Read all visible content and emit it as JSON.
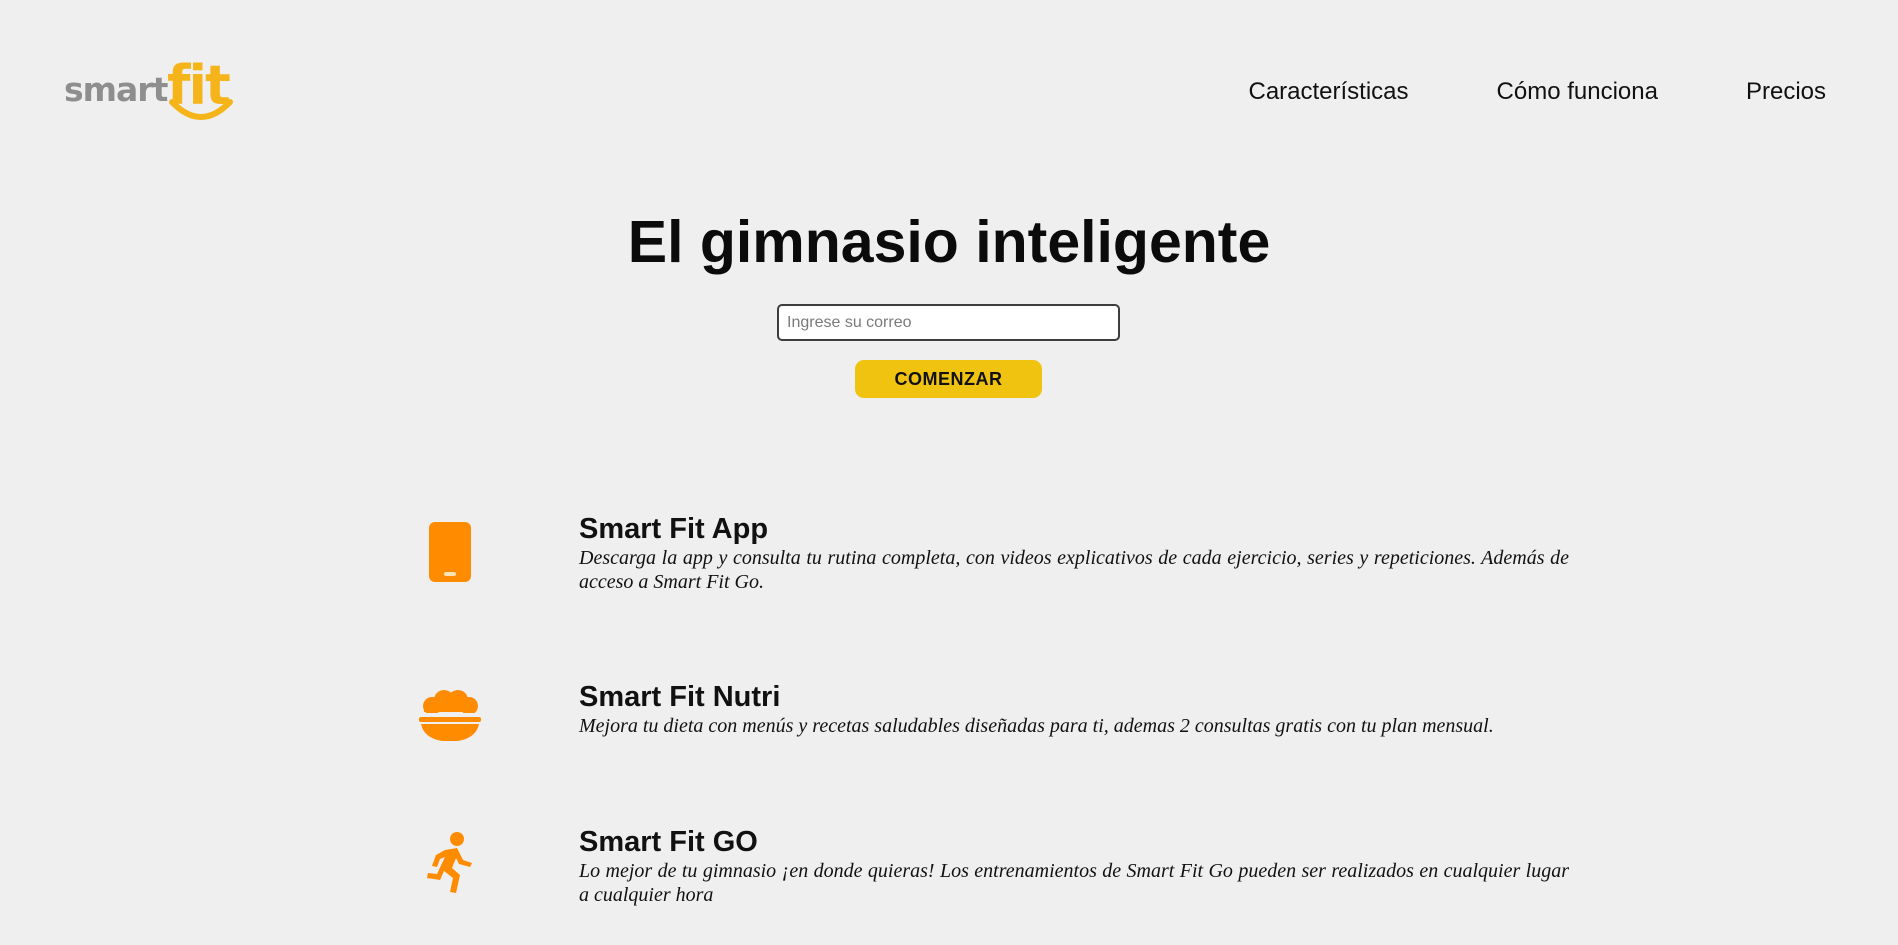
{
  "brand": {
    "logo_word1": "smart",
    "logo_word2": "fit",
    "color_gray": "#8e8e8e",
    "color_yellow": "#f6b41b"
  },
  "nav": {
    "items": [
      {
        "label": "Características"
      },
      {
        "label": "Cómo funciona"
      },
      {
        "label": "Precios"
      }
    ]
  },
  "hero": {
    "title": "El gimnasio inteligente",
    "email_placeholder": "Ingrese su correo",
    "email_value": "",
    "cta_label": "COMENZAR",
    "cta_color": "#f0c311"
  },
  "features": [
    {
      "icon": "smartphone-icon",
      "title": "Smart Fit App",
      "description": "Descarga la app y consulta tu rutina completa, con videos explicativos de cada ejercicio, series y repeticiones. Además de acceso a Smart Fit Go."
    },
    {
      "icon": "food-bowl-icon",
      "title": "Smart Fit Nutri",
      "description": "Mejora tu dieta con menús y recetas saludables diseñadas para ti, ademas 2 consultas gratis con tu plan mensual."
    },
    {
      "icon": "running-person-icon",
      "title": "Smart Fit GO",
      "description": "Lo mejor de tu gimnasio ¡en donde quieras! Los entrenamientos de Smart Fit Go pueden ser realizados en cualquier lugar a cualquier hora"
    }
  ],
  "colors": {
    "background": "#efefef",
    "icon_orange": "#ff8c00"
  }
}
